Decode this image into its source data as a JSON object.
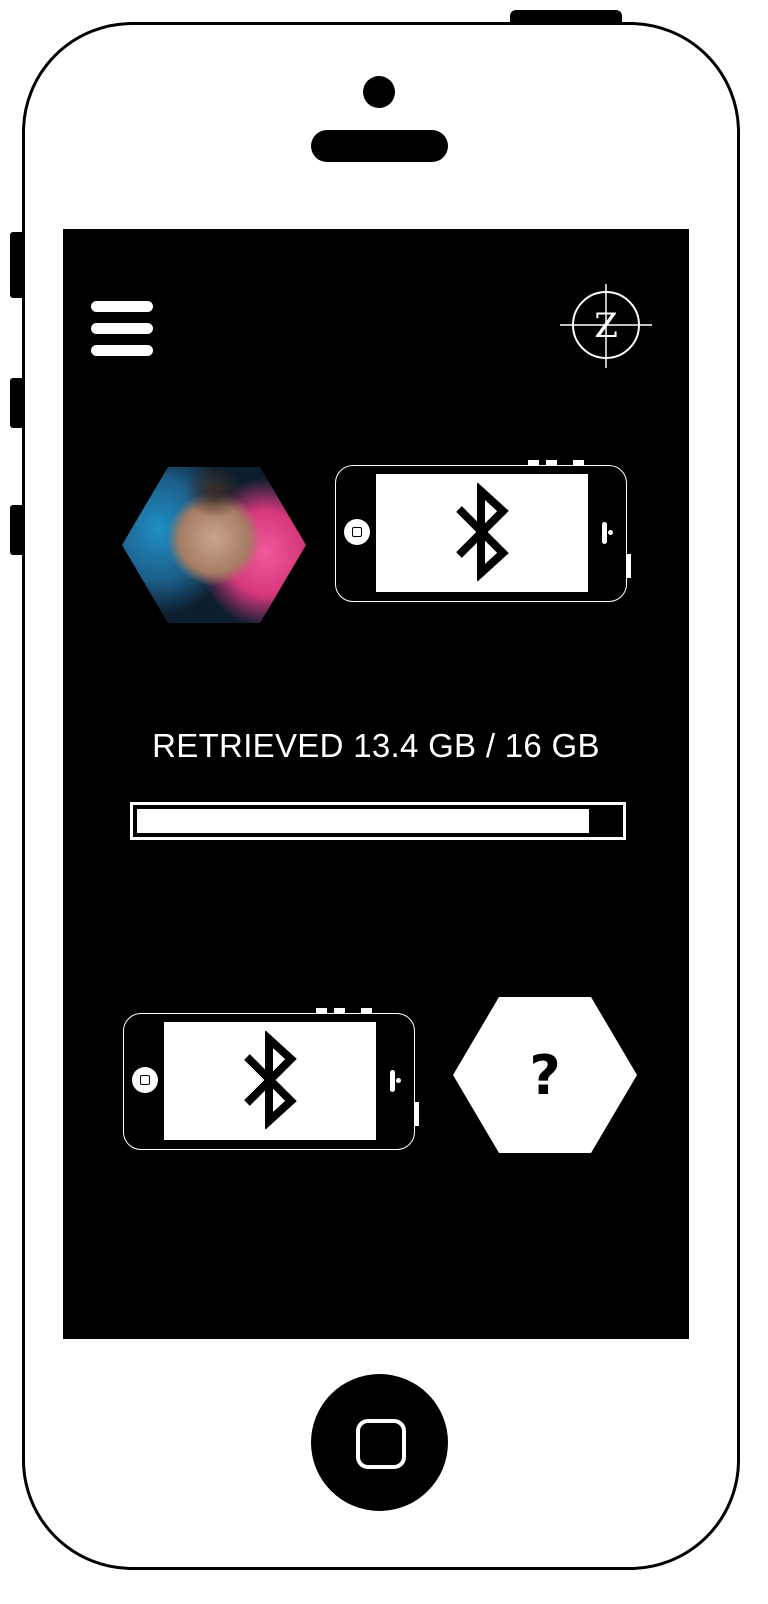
{
  "transfer": {
    "status_text": "RETRIEVED 13.4 GB / 16 GB",
    "retrieved_gb": 13.4,
    "total_gb": 16,
    "progress_fraction": 0.9375
  },
  "logo": {
    "letter": "Z"
  },
  "unknown_device": {
    "symbol": "?"
  },
  "icons": {
    "menu": "hamburger-menu-icon",
    "logo": "crosshair-z-logo",
    "source_device": "bluetooth-icon",
    "target_device": "bluetooth-icon",
    "home": "home-button-icon"
  },
  "colors": {
    "screen_bg": "#000000",
    "foreground": "#ffffff"
  }
}
